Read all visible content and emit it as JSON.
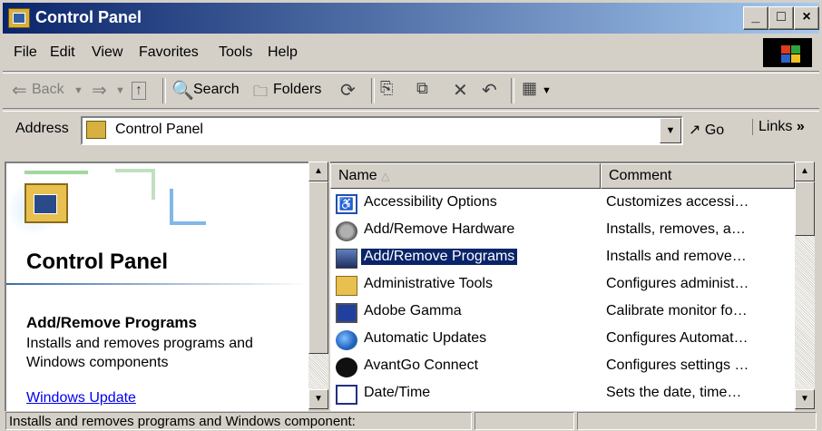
{
  "window": {
    "title": "Control Panel",
    "controls": {
      "minimize": "_",
      "maximize": "□",
      "close": "×"
    }
  },
  "menu": [
    "File",
    "Edit",
    "View",
    "Favorites",
    "Tools",
    "Help"
  ],
  "toolbar": {
    "back": "Back",
    "search": "Search",
    "folders": "Folders"
  },
  "address": {
    "label": "Address",
    "value": "Control Panel",
    "go": "Go",
    "links": "Links",
    "links_chevron": "»"
  },
  "left_pane": {
    "title": "Control Panel",
    "selected_title": "Add/Remove Programs",
    "selected_description": "Installs and removes programs and Windows components",
    "link": "Windows Update"
  },
  "list": {
    "columns": {
      "name": "Name",
      "comment": "Comment"
    },
    "rows": [
      {
        "name": "Accessibility Options",
        "comment": "Customizes accessi…",
        "icon": "accessibility-icon"
      },
      {
        "name": "Add/Remove Hardware",
        "comment": "Installs, removes, a…",
        "icon": "hardware-icon"
      },
      {
        "name": "Add/Remove Programs",
        "comment": "Installs and remove…",
        "icon": "programs-icon",
        "selected": true
      },
      {
        "name": "Administrative Tools",
        "comment": "Configures administ…",
        "icon": "admin-tools-icon"
      },
      {
        "name": "Adobe Gamma",
        "comment": "Calibrate monitor fo…",
        "icon": "monitor-icon"
      },
      {
        "name": "Automatic Updates",
        "comment": "Configures Automat…",
        "icon": "globe-icon"
      },
      {
        "name": "AvantGo Connect",
        "comment": "Configures settings …",
        "icon": "avantgo-icon"
      },
      {
        "name": "Date/Time",
        "comment": "Sets the date, time…",
        "icon": "calendar-icon"
      }
    ]
  },
  "status": {
    "text": "Installs and removes programs and Windows component:"
  },
  "colors": {
    "title_start": "#0a246a",
    "title_end": "#a6caf0",
    "selection": "#0a246a",
    "chrome": "#d4d0c8"
  }
}
